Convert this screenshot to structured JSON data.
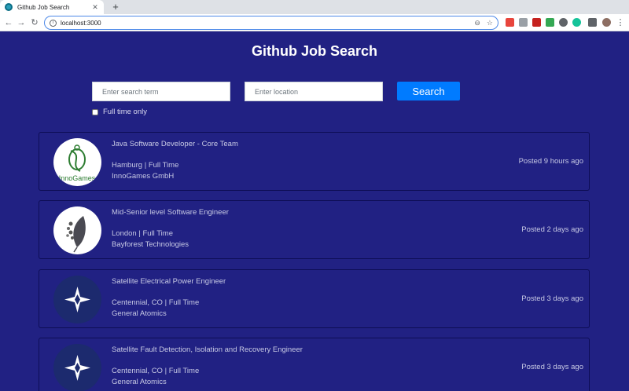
{
  "browser": {
    "tab_title": "Github Job Search",
    "tab_close": "✕",
    "new_tab": "+",
    "url": "localhost:3000",
    "back": "←",
    "forward": "→",
    "reload": "↻",
    "zoom_icon": "⊖",
    "star_icon": "☆",
    "menu_icon": "⋮"
  },
  "page": {
    "title": "Github Job Search",
    "search_placeholder": "Enter search term",
    "location_placeholder": "Enter location",
    "search_button": "Search",
    "fulltime_label": "Full time only"
  },
  "jobs": [
    {
      "title": "Java Software Developer - Core Team",
      "location": "Hamburg | Full Time",
      "company": "InnoGames GmbH",
      "posted": "Posted 9 hours ago",
      "logo": "innogames"
    },
    {
      "title": "Mid-Senior level Software Engineer",
      "location": "London | Full Time",
      "company": "Bayforest Technologies",
      "posted": "Posted 2 days ago",
      "logo": "bayforest"
    },
    {
      "title": "Satellite Electrical Power Engineer",
      "location": "Centennial, CO | Full Time",
      "company": "General Atomics",
      "posted": "Posted 3 days ago",
      "logo": "general-atomics"
    },
    {
      "title": "Satellite Fault Detection, Isolation and Recovery Engineer",
      "location": "Centennial, CO | Full Time",
      "company": "General Atomics",
      "posted": "Posted 3 days ago",
      "logo": "general-atomics"
    }
  ],
  "colors": {
    "page_bg": "#212183",
    "button": "#007bff",
    "text": "#c7c9e4",
    "logo_dark": "#1c2a6e"
  }
}
